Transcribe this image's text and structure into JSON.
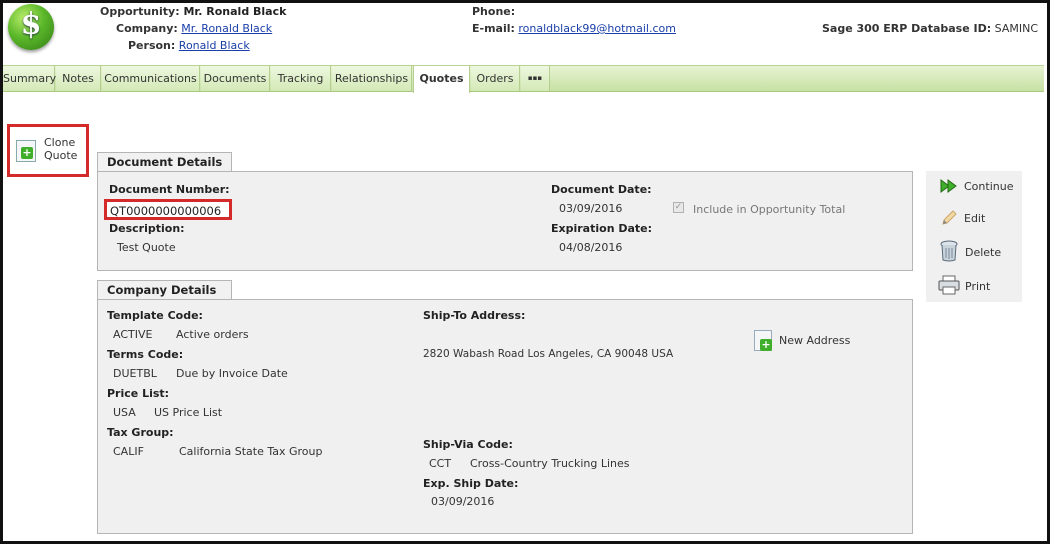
{
  "header": {
    "opportunity_label": "Opportunity:",
    "opportunity_value": "Mr. Ronald Black",
    "company_label": "Company:",
    "company_value": "Mr. Ronald Black",
    "person_label": "Person:",
    "person_value": "Ronald Black",
    "phone_label": "Phone:",
    "email_label": "E-mail:",
    "email_value": "ronaldblack99@hotmail.com",
    "erp_label": "Sage 300 ERP Database ID:",
    "erp_value": "SAMINC",
    "logo_symbol": "$"
  },
  "tabs": [
    {
      "label": "Summary"
    },
    {
      "label": "Notes"
    },
    {
      "label": "Communications"
    },
    {
      "label": "Documents"
    },
    {
      "label": "Tracking"
    },
    {
      "label": "Relationships"
    },
    {
      "label": "Quotes",
      "active": true
    },
    {
      "label": "Orders"
    },
    {
      "label": "▪▪▪"
    }
  ],
  "clone_quote": {
    "line1": "Clone",
    "line2": "Quote",
    "icon": "add-document-icon"
  },
  "document_details": {
    "title": "Document Details",
    "doc_number_label": "Document Number:",
    "doc_number_value": "QT0000000000006",
    "description_label": "Description:",
    "description_value": "Test Quote",
    "doc_date_label": "Document Date:",
    "doc_date_value": "03/09/2016",
    "include_label": "Include in Opportunity Total",
    "include_checked": true,
    "exp_date_label": "Expiration Date:",
    "exp_date_value": "04/08/2016"
  },
  "actions": [
    {
      "label": "Continue",
      "icon": "fast-forward-icon"
    },
    {
      "label": "Edit",
      "icon": "pencil-icon"
    },
    {
      "label": "Delete",
      "icon": "trash-icon"
    },
    {
      "label": "Print",
      "icon": "printer-icon"
    }
  ],
  "company_details": {
    "title": "Company Details",
    "template_code_label": "Template Code:",
    "template_code": "ACTIVE",
    "template_desc": "Active orders",
    "terms_code_label": "Terms Code:",
    "terms_code": "DUETBL",
    "terms_desc": "Due by Invoice Date",
    "price_list_label": "Price List:",
    "price_list_code": "USA",
    "price_list_desc": "US Price List",
    "tax_group_label": "Tax Group:",
    "tax_group_code": "CALIF",
    "tax_group_desc": "California State Tax Group",
    "ship_to_label": "Ship-To Address:",
    "ship_to_value": "2820 Wabash Road Los Angeles, CA 90048 USA",
    "new_address_label": "New Address",
    "ship_via_label": "Ship-Via Code:",
    "ship_via_code": "CCT",
    "ship_via_desc": "Cross-Country Trucking Lines",
    "exp_ship_label": "Exp. Ship Date:",
    "exp_ship_value": "03/09/2016"
  },
  "colors": {
    "accent_green": "#5cb82a",
    "highlight_red": "#d42a2a",
    "link_blue": "#1a3fa8",
    "tab_bg": "#d3e9b6"
  }
}
